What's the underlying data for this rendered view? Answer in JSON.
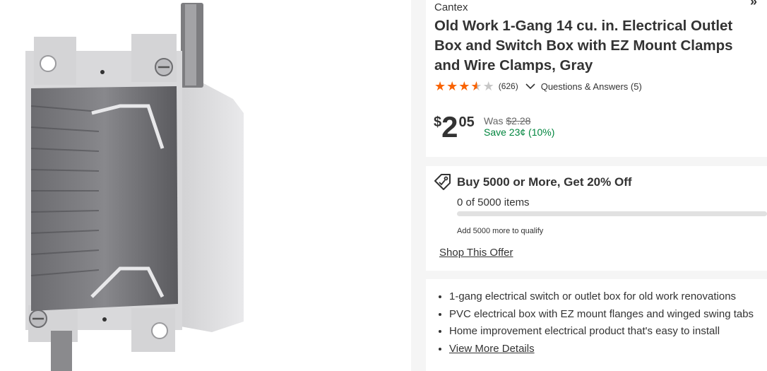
{
  "product": {
    "brand": "Cantex",
    "title": "Old Work 1-Gang 14 cu. in. Electrical Outlet Box and Switch Box with EZ Mount Clamps and Wire Clamps, Gray",
    "image_alt": "Gray PVC 1-gang old work electrical box"
  },
  "rating": {
    "stars": 3.5,
    "star_icon": "star-icon",
    "review_count": "(626)",
    "qa_label": "Questions & Answers (5)",
    "star_color": "#f96302"
  },
  "price": {
    "currency": "$",
    "whole": "2",
    "cents": "05",
    "was_label": "Was",
    "was_price": "$2.28",
    "save_text": "Save 23¢ (10%)",
    "save_color": "#00853e"
  },
  "offer": {
    "icon": "tag-icon",
    "title": "Buy 5000 or More, Get 20% Off",
    "progress_text": "0 of 5000 items",
    "progress_fraction": 0,
    "qualify_note": "Add 5000 more to qualify",
    "link_label": "Shop This Offer"
  },
  "bullets": [
    "1-gang electrical switch or outlet box for old work renovations",
    "PVC electrical box with EZ mount flanges and winged swing tabs",
    "Home improvement electrical product that's easy to install"
  ],
  "details_link": "View More Details",
  "corner_icon": "chevron-icon",
  "corner_glyph": "»"
}
